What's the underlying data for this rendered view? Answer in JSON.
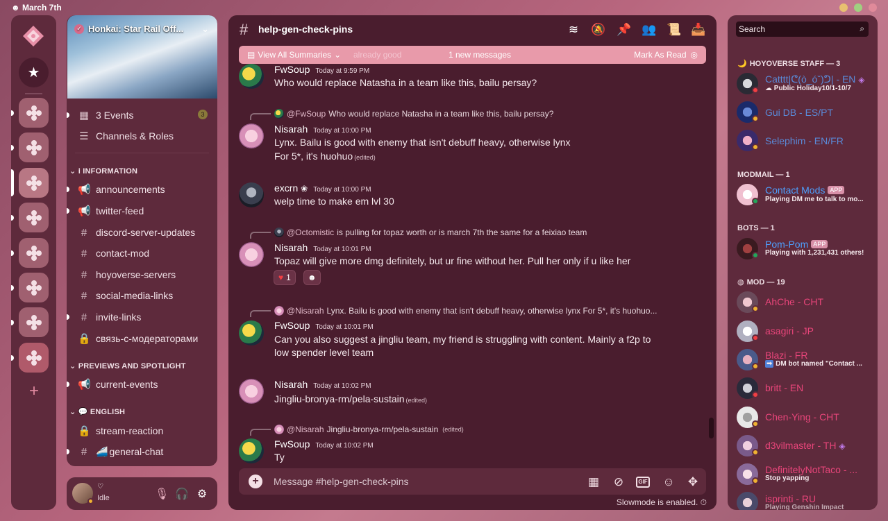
{
  "window": {
    "title": "March 7th",
    "dots": [
      "#e8c070",
      "#a0d080",
      "#e08a9a"
    ]
  },
  "colors": {
    "accent": "#e89aaa",
    "staff": "#5a8ad8",
    "bot": "#4ea0ff",
    "mod": "#e8457a",
    "idle": "#f0b232",
    "online": "#23a55a",
    "dnd": "#f23f43"
  },
  "server": {
    "name": "Honkai: Star Rail Off...",
    "events_label": "3 Events",
    "events_count": "3",
    "channels_roles": "Channels & Roles"
  },
  "categories": [
    {
      "label": "i INFORMATION",
      "channels": [
        "announcements",
        "twitter-feed",
        "discord-server-updates",
        "contact-mod",
        "hoyoverse-servers",
        "social-media-links",
        "invite-links",
        "связь-с-модераторами"
      ]
    },
    {
      "label": "PREVIEWS AND SPOTLIGHT",
      "channels": [
        "current-events"
      ]
    },
    {
      "label": "ENGLISH",
      "channels": [
        "stream-reaction",
        "general-chat"
      ]
    }
  ],
  "user": {
    "name_icon": "♡",
    "status": "Idle"
  },
  "channel": {
    "name": "help-gen-check-pins"
  },
  "notice": {
    "summaries": "View All Summaries",
    "ghost": "already good",
    "new_messages": "1 new messages",
    "mark_read": "Mark As Read"
  },
  "messages": [
    {
      "author": "FwSoup",
      "time": "Today at 9:59 PM",
      "lines": [
        "Who would replace Natasha in a team like this, bailu persay?"
      ]
    },
    {
      "reply_to": "@FwSoup",
      "reply_text": "Who would replace Natasha in a team like this, bailu persay?",
      "author": "Nisarah",
      "time": "Today at 10:00 PM",
      "lines": [
        "Lynx. Bailu is good with enemy that isn't debuff heavy, otherwise lynx",
        "For 5*, it's huohuo"
      ],
      "edited": "(edited)"
    },
    {
      "author": "excrn",
      "time": "Today at 10:00 PM",
      "lines": [
        "welp time to make em lvl 30"
      ]
    },
    {
      "reply_to": "@Octomistic",
      "reply_text": "is pulling for topaz worth or is march 7th the same for a feixiao team",
      "author": "Nisarah",
      "time": "Today at 10:01 PM",
      "lines": [
        "Topaz will give more dmg definitely, but ur fine without her. Pull her only if u like her"
      ],
      "reaction_count": "1"
    },
    {
      "reply_to": "@Nisarah",
      "reply_text": "Lynx. Bailu is good with enemy that isn't debuff heavy, otherwise lynx For 5*, it's huohuo...",
      "author": "FwSoup",
      "time": "Today at 10:01 PM",
      "lines": [
        "Can you also suggest a jingliu team, my friend is struggling with content. Mainly a f2p to",
        "low spender level team"
      ]
    },
    {
      "author": "Nisarah",
      "time": "Today at 10:02 PM",
      "lines": [
        "Jingliu-bronya-rm/pela-sustain"
      ],
      "edited": "(edited)"
    },
    {
      "reply_to": "@Nisarah",
      "reply_text": "Jingliu-bronya-rm/pela-sustain",
      "reply_edited": "(edited)",
      "author": "FwSoup",
      "time": "Today at 10:02 PM",
      "lines": [
        "Ty"
      ]
    }
  ],
  "composer": {
    "placeholder": "Message #help-gen-check-pins",
    "gif": "GIF",
    "slowmode": "Slowmode is enabled."
  },
  "members": {
    "search": "Search",
    "groups": [
      {
        "label": "HOYOVERSE STAFF — 3",
        "members": [
          {
            "name": "Catttt|ᕦ(ò_óˇ)ᕤ| - EN",
            "sub": "Public Holiday10/1-10/7"
          },
          {
            "name": "Gui DB - ES/PT"
          },
          {
            "name": "Selephim - EN/FR"
          }
        ]
      },
      {
        "label": "MODMAIL — 1",
        "members": [
          {
            "name": "Contact Mods",
            "tag": "APP",
            "sub": "Playing DM me to talk to mo..."
          }
        ]
      },
      {
        "label": "BOTS — 1",
        "members": [
          {
            "name": "Pom-Pom",
            "tag": "APP",
            "sub": "Playing with 1,231,431 others!"
          }
        ]
      },
      {
        "label": "MOD — 19",
        "members": [
          {
            "name": "AhChe - CHT"
          },
          {
            "name": "asagiri - JP"
          },
          {
            "name": "Blazi - FR",
            "sub": "DM bot named \"Contact ..."
          },
          {
            "name": "britt - EN"
          },
          {
            "name": "Chen-Ying - CHT"
          },
          {
            "name": "d3vilmaster - TH"
          },
          {
            "name": "DefinitelyNotTaco - ...",
            "sub": "Stop yapping"
          },
          {
            "name": "isprinti - RU",
            "sub": "Playing Genshin Impact"
          }
        ]
      }
    ]
  }
}
